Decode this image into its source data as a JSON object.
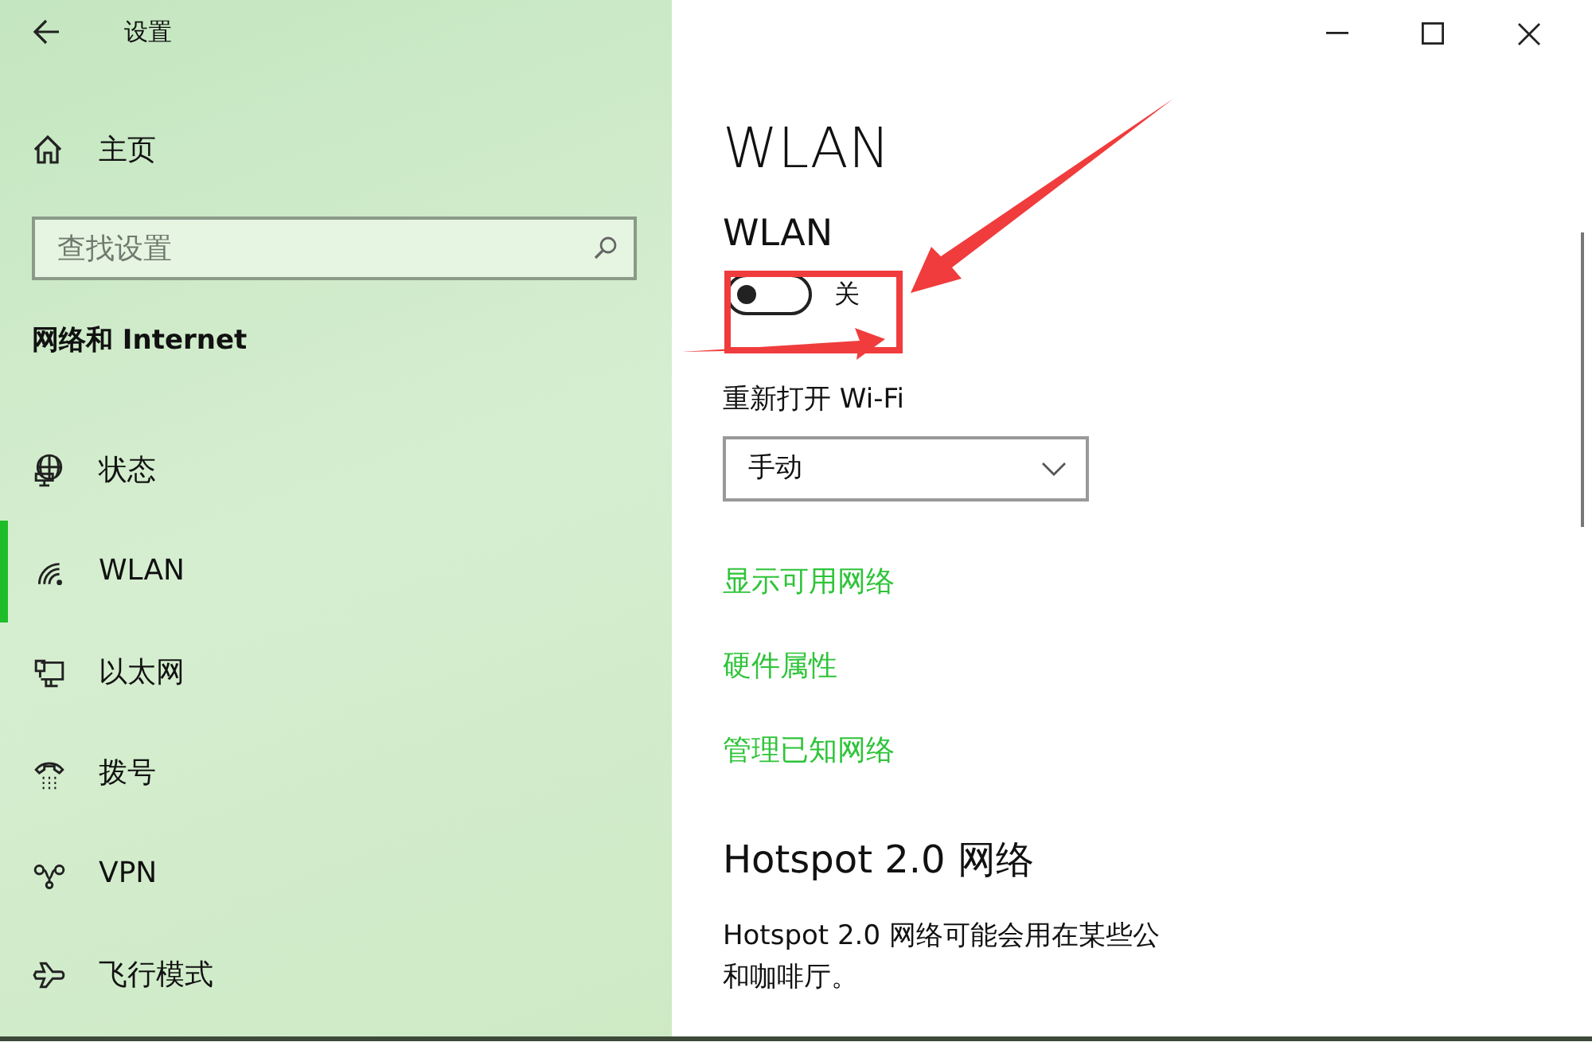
{
  "window": {
    "title": "设置"
  },
  "sidebar": {
    "home": "主页",
    "search": {
      "placeholder": "查找设置"
    },
    "section": "网络和 Internet",
    "items": [
      {
        "kind": "status",
        "label": "状态",
        "selected": false
      },
      {
        "kind": "wifi",
        "label": "WLAN",
        "selected": true
      },
      {
        "kind": "ethernet",
        "label": "以太网",
        "selected": false
      },
      {
        "kind": "dialup",
        "label": "拨号",
        "selected": false
      },
      {
        "kind": "vpn",
        "label": "VPN",
        "selected": false
      },
      {
        "kind": "airplane",
        "label": "飞行模式",
        "selected": false
      }
    ]
  },
  "content": {
    "title": "WLAN",
    "toggle": {
      "label": "WLAN",
      "on": false,
      "state_text": "关"
    },
    "reopen": {
      "label": "重新打开 Wi-Fi",
      "value": "手动"
    },
    "links": [
      "显示可用网络",
      "硬件属性",
      "管理已知网络"
    ],
    "hotspot": {
      "heading": "Hotspot 2.0 网络",
      "lines": [
        "Hotspot 2.0 网络可能会用在某些公",
        "和咖啡厅。"
      ]
    }
  }
}
